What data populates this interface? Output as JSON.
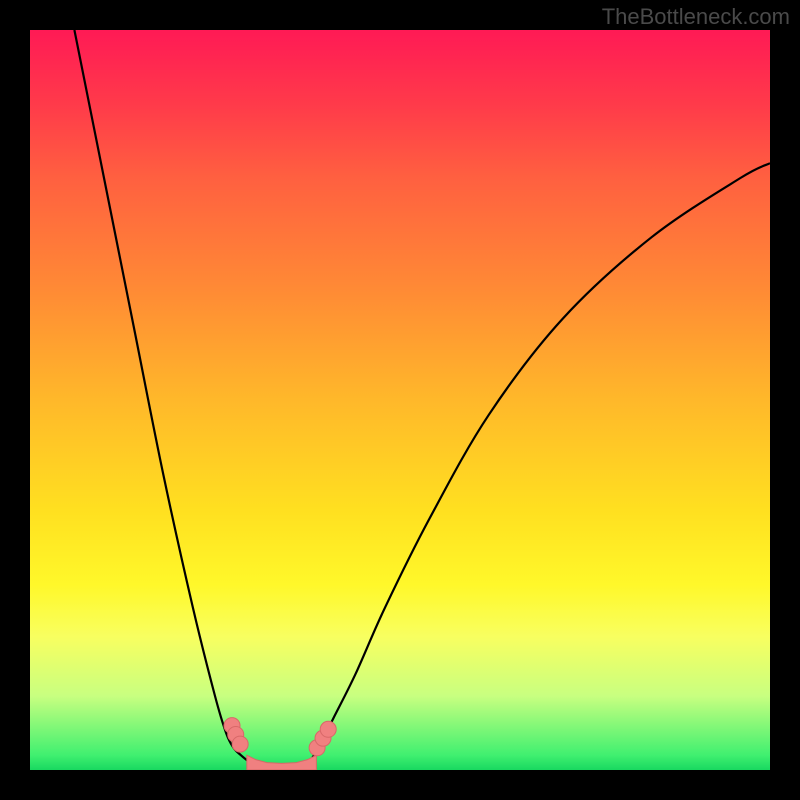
{
  "watermark": "TheBottleneck.com",
  "chart_data": {
    "type": "line",
    "title": "",
    "xlabel": "",
    "ylabel": "",
    "xlim": [
      0,
      100
    ],
    "ylim": [
      0,
      100
    ],
    "series": [
      {
        "name": "left-branch",
        "x": [
          6,
          10,
          14,
          18,
          22,
          25,
          26.5,
          27.5,
          28.5,
          29.5,
          30.5
        ],
        "y": [
          100,
          80,
          60,
          40,
          22,
          10,
          5,
          3,
          2,
          1.2,
          0.7
        ]
      },
      {
        "name": "valley-floor",
        "x": [
          30.5,
          32,
          34,
          36,
          37.5
        ],
        "y": [
          0.7,
          0.3,
          0.2,
          0.3,
          0.7
        ]
      },
      {
        "name": "right-branch",
        "x": [
          37.5,
          39,
          41,
          44,
          48,
          54,
          62,
          72,
          84,
          96,
          100
        ],
        "y": [
          0.7,
          3,
          7,
          13,
          22,
          34,
          48,
          61,
          72,
          80,
          82
        ]
      }
    ],
    "markers": [
      {
        "name": "left-dot-1",
        "x": 27.3,
        "y": 6.0
      },
      {
        "name": "left-dot-2",
        "x": 27.8,
        "y": 4.8
      },
      {
        "name": "left-dot-3",
        "x": 28.4,
        "y": 3.5
      },
      {
        "name": "right-dot-1",
        "x": 38.8,
        "y": 3.0
      },
      {
        "name": "right-dot-2",
        "x": 39.6,
        "y": 4.3
      },
      {
        "name": "right-dot-3",
        "x": 40.3,
        "y": 5.5
      }
    ],
    "valley_band": {
      "x": [
        29.3,
        30.5,
        32,
        34,
        36,
        37.5,
        38.7
      ],
      "y_top": [
        2.0,
        1.4,
        1.0,
        0.9,
        1.0,
        1.4,
        2.0
      ]
    },
    "colors": {
      "curve": "#000000",
      "marker": "#f08080",
      "marker_stroke": "#d86868"
    }
  }
}
